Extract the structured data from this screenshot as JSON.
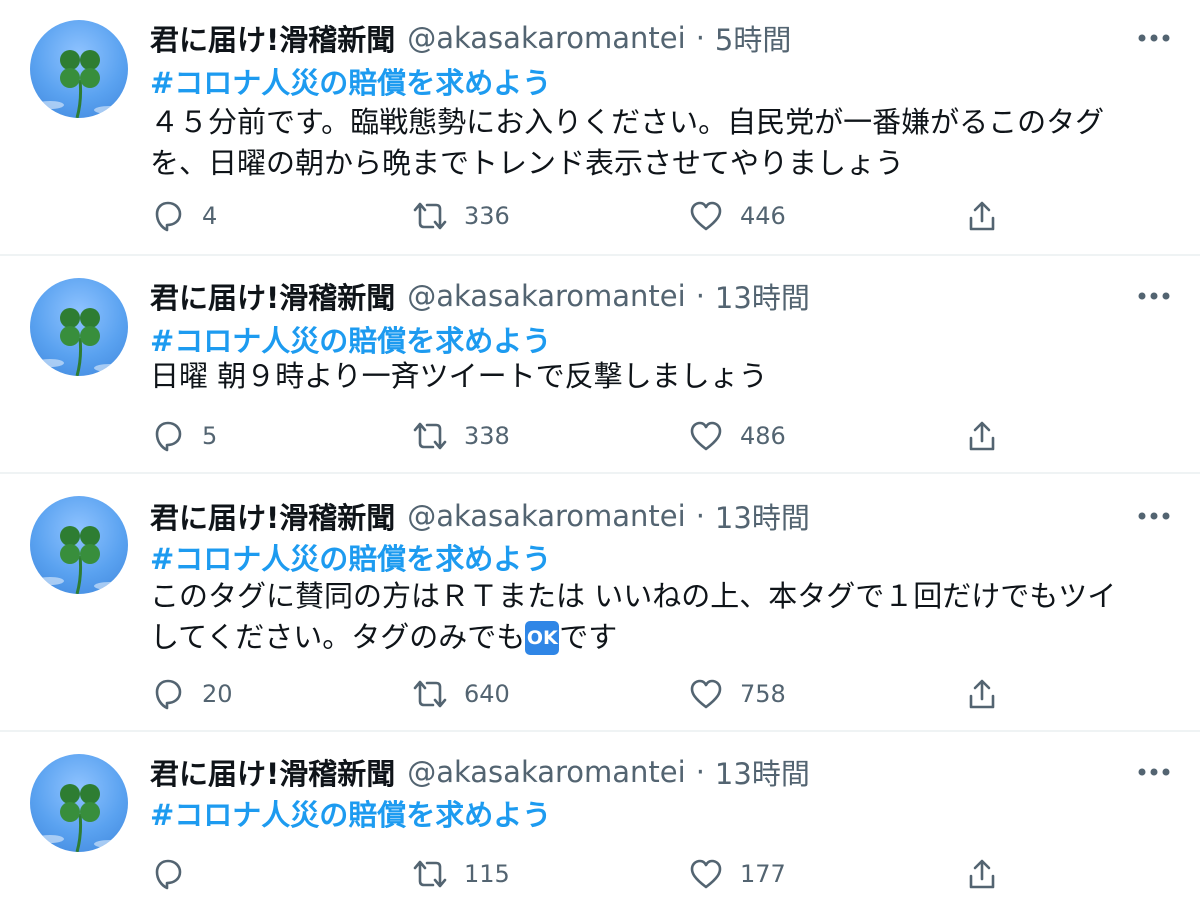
{
  "tweets": [
    {
      "name": "君に届け!滑稽新聞",
      "handle": "@akasakaromantei",
      "separator": "·",
      "time": "5時間",
      "hashtag": "#コロナ人災の賠償を求めよう",
      "lines": [
        "４５分前です。臨戦態勢にお入りください。自民党が一番嫌がるこのタグ",
        "を、日曜の朝から晩までトレンド表示させてやりましょう"
      ],
      "replies": "4",
      "retweets": "336",
      "likes": "446"
    },
    {
      "name": "君に届け!滑稽新聞",
      "handle": "@akasakaromantei",
      "separator": "·",
      "time": "13時間",
      "hashtag": "#コロナ人災の賠償を求めよう",
      "lines": [
        "日曜 朝９時より一斉ツイートで反撃しましょう"
      ],
      "replies": "5",
      "retweets": "338",
      "likes": "486"
    },
    {
      "name": "君に届け!滑稽新聞",
      "handle": "@akasakaromantei",
      "separator": "·",
      "time": "13時間",
      "hashtag": "#コロナ人災の賠償を求めよう",
      "lines": [
        "このタグに賛同の方はＲＴまたは いいねの上、本タグで１回だけでもツイ"
      ],
      "line2_before": "してください。タグのみでも",
      "ok_emoji": "OK",
      "line2_after": "です",
      "replies": "20",
      "retweets": "640",
      "likes": "758"
    },
    {
      "name": "君に届け!滑稽新聞",
      "handle": "@akasakaromantei",
      "separator": "·",
      "time": "13時間",
      "hashtag": "#コロナ人災の賠償を求めよう",
      "lines": [],
      "replies": "",
      "retweets": "115",
      "likes": "177"
    }
  ],
  "icons": {
    "avatar": "four-leaf-clover-icon",
    "more": "more-horizontal-icon",
    "reply": "reply-icon",
    "retweet": "retweet-icon",
    "like": "heart-icon",
    "share": "share-icon"
  },
  "colors": {
    "hashtag": "#1d9bf0",
    "secondary_text": "#536471",
    "icon": "#536471",
    "divider": "#eff3f4",
    "avatar_sky": "#5aa2f0",
    "clover": "#2e7d32"
  }
}
